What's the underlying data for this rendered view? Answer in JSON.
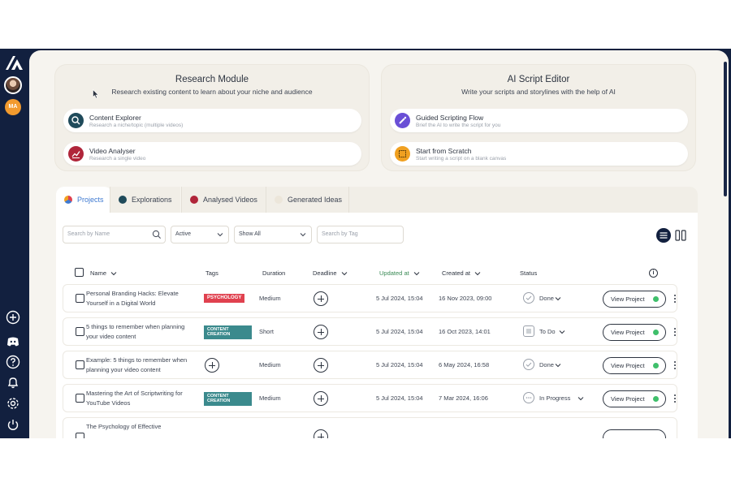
{
  "sidebar": {
    "initials": "MA",
    "icons": [
      "plus-circle-icon",
      "discord-icon",
      "help-icon",
      "bell-icon",
      "settings-icon",
      "power-icon"
    ]
  },
  "research_module": {
    "title": "Research Module",
    "subtitle": "Research existing content to learn about your niche and audience",
    "items": [
      {
        "title": "Content Explorer",
        "desc": "Research a niche/topic (multiple videos)",
        "icon": "search-icon",
        "color": "#1f4a5a"
      },
      {
        "title": "Video Analyser",
        "desc": "Research a single video",
        "icon": "chart-icon",
        "color": "#b0253a"
      }
    ]
  },
  "ai_script_editor": {
    "title": "AI Script Editor",
    "subtitle": "Write your scripts and storylines with the help of AI",
    "items": [
      {
        "title": "Guided Scripting Flow",
        "desc": "Brief the AI to write the script for you",
        "icon": "wand-icon",
        "color": "#6a4fd6"
      },
      {
        "title": "Start from Scratch",
        "desc": "Start writing a script on a blank canvas",
        "icon": "canvas-icon",
        "color": "#f0a020"
      }
    ]
  },
  "tabs": [
    {
      "label": "Projects",
      "active": true
    },
    {
      "label": "Explorations",
      "active": false
    },
    {
      "label": "Analysed Videos",
      "active": false
    },
    {
      "label": "Generated Ideas",
      "active": false
    }
  ],
  "filters": {
    "search_name_placeholder": "Search by Name",
    "status_value": "Active",
    "show_value": "Show All",
    "search_tag_placeholder": "Search by Tag"
  },
  "table": {
    "headers": {
      "name": "Name",
      "tags": "Tags",
      "duration": "Duration",
      "deadline": "Deadline",
      "updated": "Updated at",
      "created": "Created at",
      "status": "Status"
    },
    "view_label": "View Project",
    "rows": [
      {
        "name": "Personal Branding Hacks: Elevate Yourself in a Digital World",
        "tag": "PSYCHOLOGY",
        "duration": "Medium",
        "updated": "5 Jul 2024, 15:04",
        "created": "16 Nov 2023, 09:00",
        "status": "Done"
      },
      {
        "name": "5 things to remember when planning your video content",
        "tag": "CONTENT CREATION",
        "duration": "Short",
        "updated": "5 Jul 2024, 15:04",
        "created": "16 Oct 2023, 14:01",
        "status": "To Do"
      },
      {
        "name": "Example: 5 things to remember when planning your video content",
        "tag": "",
        "duration": "Medium",
        "updated": "5 Jul 2024, 15:04",
        "created": "6 May 2024, 16:58",
        "status": "Done"
      },
      {
        "name": "Mastering the Art of Scriptwriting for YouTube Videos",
        "tag": "CONTENT CREATION",
        "duration": "Medium",
        "updated": "5 Jul 2024, 15:04",
        "created": "7 Mar 2024, 16:06",
        "status": "In Progress"
      },
      {
        "name": "The Psychology of Effective",
        "tag": "",
        "duration": "",
        "updated": "",
        "created": "",
        "status": ""
      }
    ]
  }
}
